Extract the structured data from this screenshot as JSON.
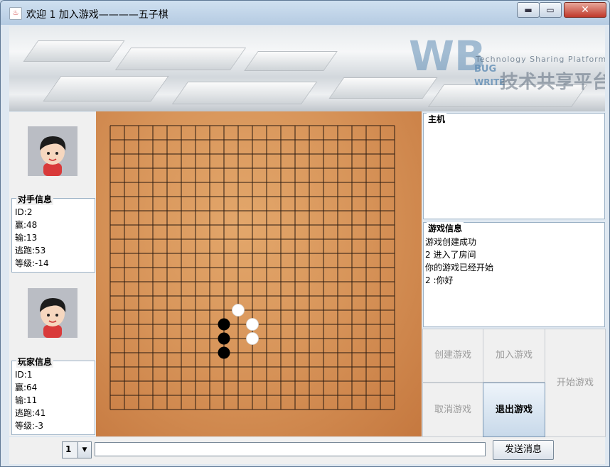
{
  "window": {
    "title": "欢迎 1 加入游戏————五子棋",
    "minimize": "▬",
    "maximize": "▭",
    "close": "✕"
  },
  "watermark": {
    "logo": "WB",
    "bug": "BUG",
    "write": "WRITE",
    "tagline": "Technology Sharing Platform",
    "cn": "技术共享平台"
  },
  "opponent": {
    "title": "对手信息",
    "id": "ID:2",
    "wins": "赢:48",
    "losses": "输:13",
    "escapes": "逃跑:53",
    "level": "等级:-14"
  },
  "player": {
    "title": "玩家信息",
    "id": "ID:1",
    "wins": "赢:64",
    "losses": "输:11",
    "escapes": "逃跑:41",
    "level": "等级:-3"
  },
  "board": {
    "size": 20,
    "stones": [
      {
        "color": "white",
        "col": 9,
        "row": 13
      },
      {
        "color": "black",
        "col": 8,
        "row": 14
      },
      {
        "color": "white",
        "col": 10,
        "row": 14
      },
      {
        "color": "black",
        "col": 8,
        "row": 15
      },
      {
        "color": "white",
        "col": 10,
        "row": 15
      },
      {
        "color": "black",
        "col": 8,
        "row": 16
      }
    ]
  },
  "host_panel": {
    "title": "主机"
  },
  "game_info": {
    "title": "游戏信息",
    "messages": [
      "游戏创建成功",
      "2 进入了房间",
      "你的游戏已经开始",
      "2 :你好"
    ]
  },
  "buttons": {
    "create": "创建游戏",
    "join": "加入游戏",
    "start": "开始游戏",
    "cancel": "取消游戏",
    "quit": "退出游戏"
  },
  "bottom": {
    "combo_value": "1",
    "combo_arrow": "▼",
    "input_value": "",
    "send": "发送消息"
  }
}
